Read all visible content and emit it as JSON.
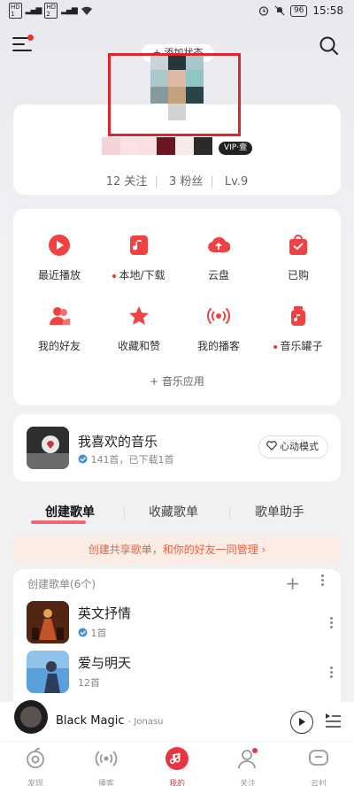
{
  "status_bar": {
    "time": "15:58",
    "battery": "96"
  },
  "header": {
    "add_status": "+ 添加状态"
  },
  "profile": {
    "vip_badge": "VIP·壹",
    "follow": "12 关注",
    "fans": "3 粉丝",
    "level": "Lv.9"
  },
  "functions": [
    {
      "label": "最近播放",
      "icon": "play-circle-icon",
      "dot": false
    },
    {
      "label": "本地/下载",
      "icon": "music-file-icon",
      "dot": true
    },
    {
      "label": "云盘",
      "icon": "cloud-upload-icon",
      "dot": false
    },
    {
      "label": "已购",
      "icon": "shopping-bag-icon",
      "dot": false
    },
    {
      "label": "我的好友",
      "icon": "friends-icon",
      "dot": false
    },
    {
      "label": "收藏和赞",
      "icon": "star-icon",
      "dot": false
    },
    {
      "label": "我的播客",
      "icon": "podcast-icon",
      "dot": false
    },
    {
      "label": "音乐罐子",
      "icon": "music-jar-icon",
      "dot": true
    }
  ],
  "music_apps": "+ 音乐应用",
  "liked": {
    "title": "我喜欢的音乐",
    "sub": "141首，已下载1首",
    "mode": "心动模式"
  },
  "tabs": [
    "创建歌单",
    "收藏歌单",
    "歌单助手"
  ],
  "share_banner": "创建共享歌单，和你的好友一同管理 ›",
  "playlists": {
    "header": "创建歌单(6个)",
    "items": [
      {
        "name": "英文抒情",
        "count": "1首",
        "downloaded": true
      },
      {
        "name": "爱与明天",
        "count": "12首",
        "downloaded": false
      }
    ]
  },
  "player": {
    "title": "Black Magic",
    "artist": "- Jonasu"
  },
  "nav": [
    {
      "label": "发现",
      "icon": "discover-icon"
    },
    {
      "label": "播客",
      "icon": "podcast-icon"
    },
    {
      "label": "我的",
      "icon": "my-music-icon"
    },
    {
      "label": "关注",
      "icon": "follow-icon"
    },
    {
      "label": "云村",
      "icon": "community-icon"
    }
  ],
  "colors": {
    "accent": "#e8353f",
    "banner_text": "#e8603c"
  }
}
